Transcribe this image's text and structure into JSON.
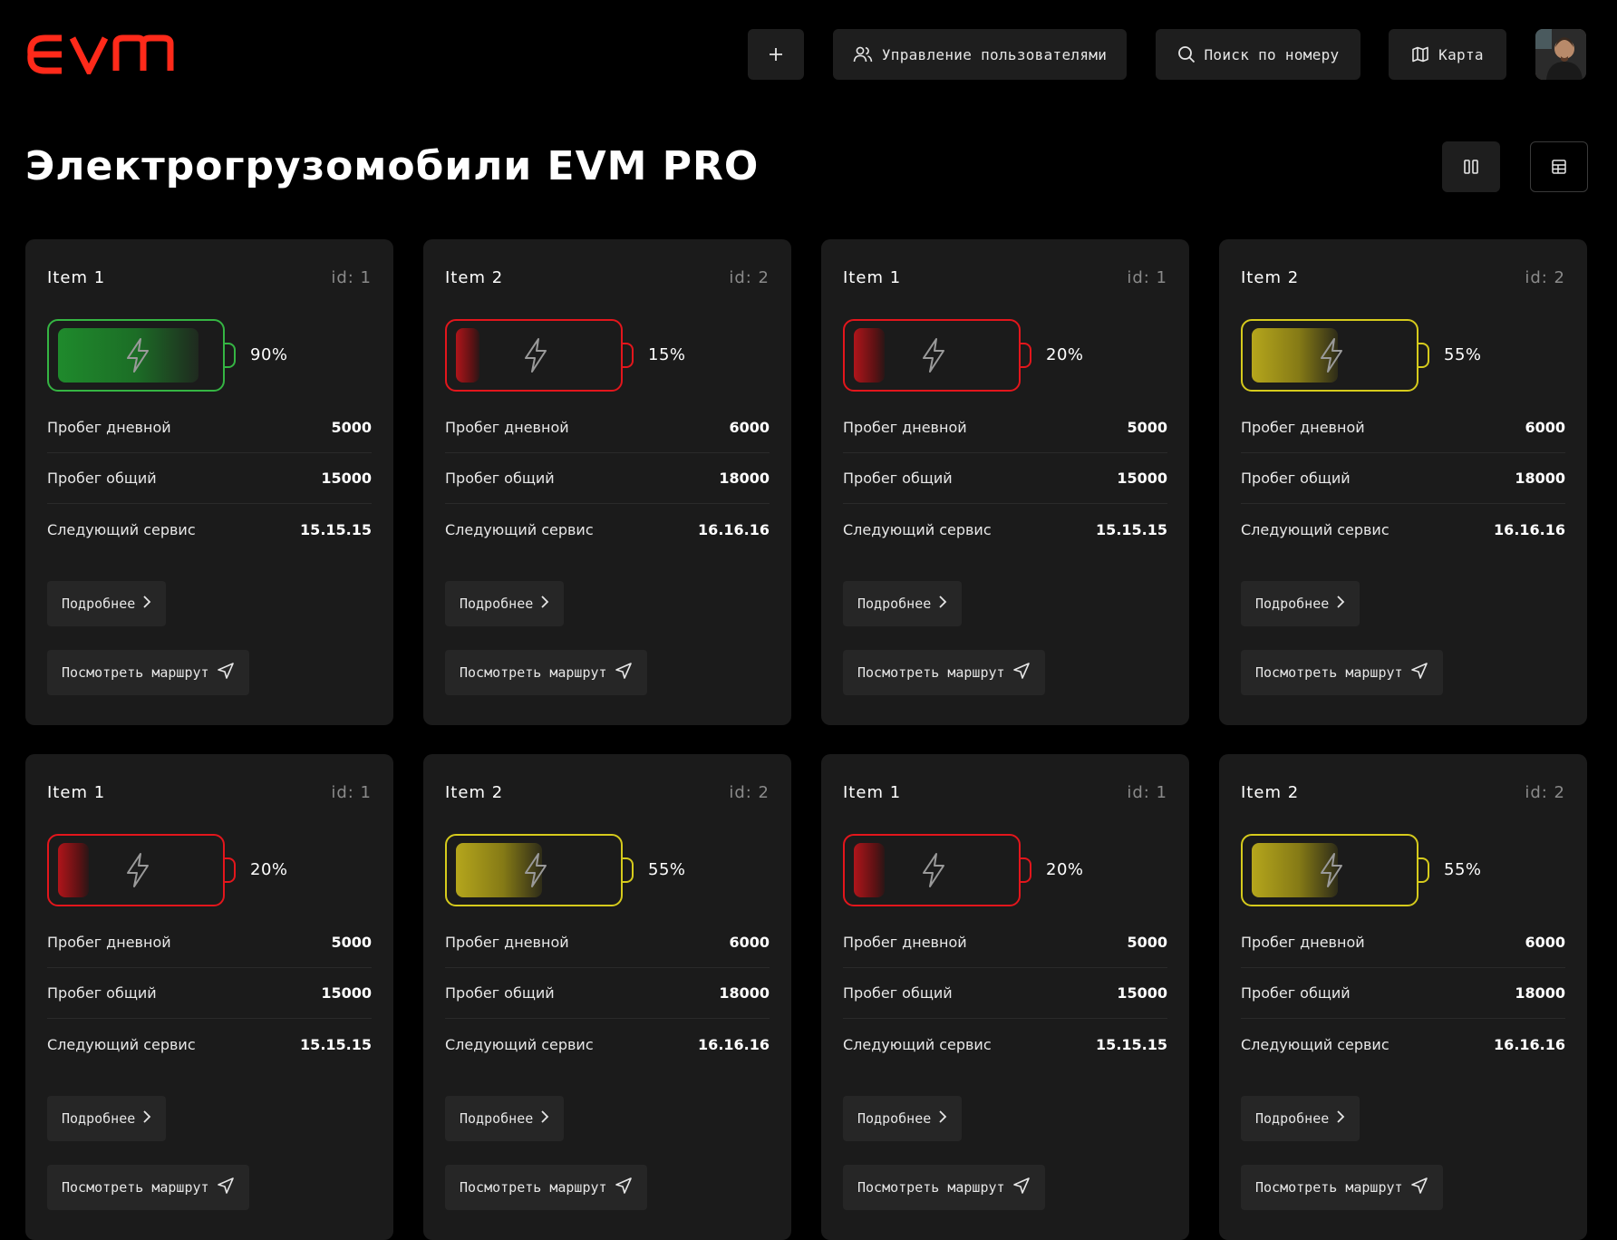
{
  "header": {
    "logo_text": "EVM",
    "add_label": "+",
    "users_label": "Управление пользователями",
    "search_label": "Поиск по номеру",
    "map_label": "Карта"
  },
  "page": {
    "title": "Электрогрузомобили EVM PRO"
  },
  "labels": {
    "daily": "Пробег дневной",
    "total": "Пробег общий",
    "service": "Следующий сервис",
    "details": "Подробнее",
    "route": "Посмотреть маршрут"
  },
  "colors": {
    "accent": "#ff2a1a",
    "green": "#3bbf4a",
    "red": "#e0161c",
    "yellow": "#d8cc1e"
  },
  "cards": [
    {
      "title": "Item 1",
      "id": "id: 1",
      "charge": 0.9,
      "charge_label": "90%",
      "status": "green",
      "daily": "5000",
      "total": "15000",
      "service": "15.15.15"
    },
    {
      "title": "Item 2",
      "id": "id: 2",
      "charge": 0.15,
      "charge_label": "15%",
      "status": "red",
      "daily": "6000",
      "total": "18000",
      "service": "16.16.16"
    },
    {
      "title": "Item 1",
      "id": "id: 1",
      "charge": 0.2,
      "charge_label": "20%",
      "status": "red",
      "daily": "5000",
      "total": "15000",
      "service": "15.15.15"
    },
    {
      "title": "Item 2",
      "id": "id: 2",
      "charge": 0.55,
      "charge_label": "55%",
      "status": "yellow",
      "daily": "6000",
      "total": "18000",
      "service": "16.16.16"
    },
    {
      "title": "Item 1",
      "id": "id: 1",
      "charge": 0.2,
      "charge_label": "20%",
      "status": "red",
      "daily": "5000",
      "total": "15000",
      "service": "15.15.15"
    },
    {
      "title": "Item 2",
      "id": "id: 2",
      "charge": 0.55,
      "charge_label": "55%",
      "status": "yellow",
      "daily": "6000",
      "total": "18000",
      "service": "16.16.16"
    },
    {
      "title": "Item 1",
      "id": "id: 1",
      "charge": 0.2,
      "charge_label": "20%",
      "status": "red",
      "daily": "5000",
      "total": "15000",
      "service": "15.15.15"
    },
    {
      "title": "Item 2",
      "id": "id: 2",
      "charge": 0.55,
      "charge_label": "55%",
      "status": "yellow",
      "daily": "6000",
      "total": "18000",
      "service": "16.16.16"
    }
  ]
}
